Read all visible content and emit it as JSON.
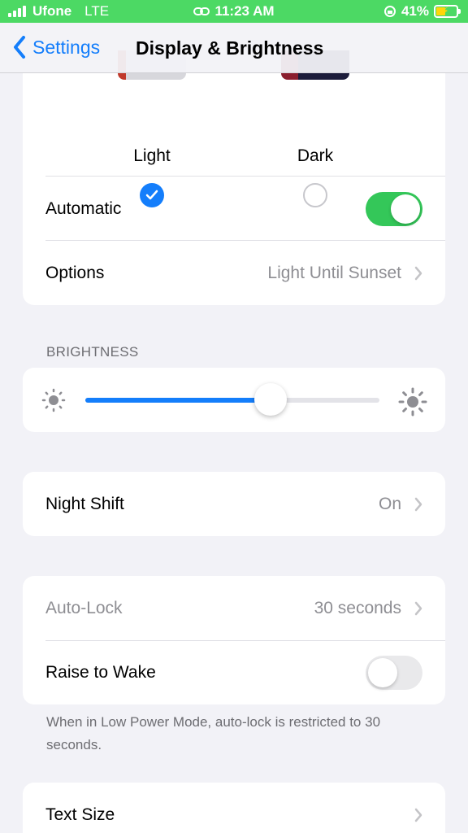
{
  "status_bar": {
    "carrier": "Ufone",
    "network": "LTE",
    "time": "11:23 AM",
    "battery": "41%",
    "battery_level": 0.41,
    "color": "#4cd964"
  },
  "nav": {
    "back_label": "Settings",
    "title": "Display & Brightness"
  },
  "appearance": {
    "light_label": "Light",
    "dark_label": "Dark",
    "selected": "Light",
    "automatic_label": "Automatic",
    "automatic_on": true,
    "options_label": "Options",
    "options_value": "Light Until Sunset"
  },
  "brightness": {
    "header": "BRIGHTNESS",
    "level": 0.63
  },
  "night_shift": {
    "label": "Night Shift",
    "value": "On"
  },
  "lock": {
    "auto_lock_label": "Auto-Lock",
    "auto_lock_value": "30 seconds",
    "raise_label": "Raise to Wake",
    "raise_on": false,
    "footnote": "When in Low Power Mode, auto-lock is restricted to 30 seconds."
  },
  "text_size": {
    "label": "Text Size"
  },
  "colors": {
    "accent": "#147efb",
    "toggle_on": "#34c759",
    "secondary_text": "#8e8e93"
  }
}
